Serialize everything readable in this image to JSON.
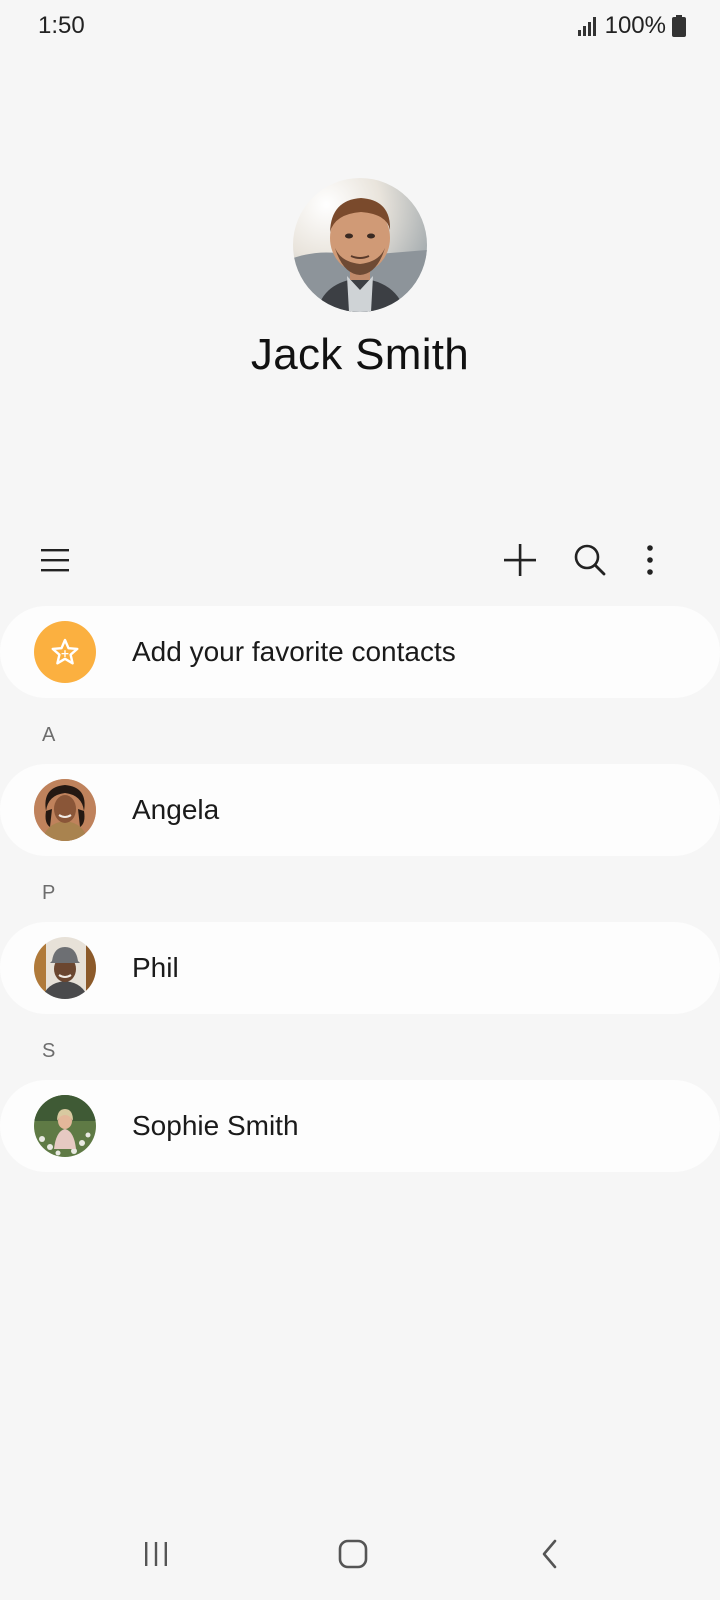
{
  "status_bar": {
    "time": "1:50",
    "battery": "100%",
    "icons": [
      "signal-icon",
      "battery-icon"
    ]
  },
  "profile": {
    "name": "Jack Smith"
  },
  "toolbar": {
    "icons": [
      "menu-icon",
      "add-icon",
      "search-icon",
      "more-options-icon"
    ]
  },
  "favorites": {
    "label": "Add your favorite contacts",
    "icon": "star-icon",
    "accent_color": "#fbb040"
  },
  "contacts": {
    "sections": [
      {
        "letter": "A",
        "name": "Angela"
      },
      {
        "letter": "P",
        "name": "Phil"
      },
      {
        "letter": "S",
        "name": "Sophie Smith"
      }
    ]
  },
  "nav_bar": {
    "icons": [
      "recent-apps-icon",
      "home-icon",
      "back-icon"
    ]
  }
}
